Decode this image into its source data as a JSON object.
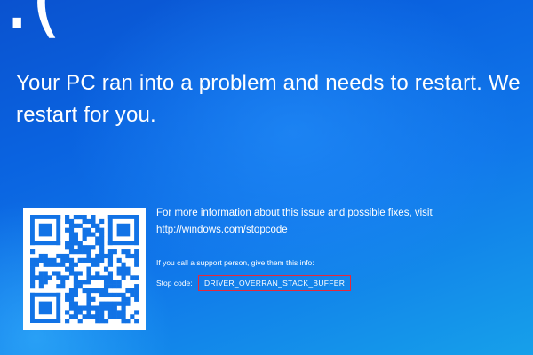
{
  "face": {
    "glyph": ":("
  },
  "headline": {
    "line1": "Your PC ran into a problem and needs to restart. We",
    "line2": "restart for you."
  },
  "qr": {
    "icon": "qr-code-icon"
  },
  "info": {
    "more_info": "For more information about this issue and possible fixes, visit",
    "url": "http://windows.com/stopcode",
    "support": "If you call a support person, give them this info:",
    "stop_code_label": "Stop code:",
    "stop_code": "DRIVER_OVERRAN_STACK_BUFFER"
  },
  "colors": {
    "background": "#0a63e0",
    "text": "#ffffff",
    "highlight_box": "#e8283a"
  }
}
